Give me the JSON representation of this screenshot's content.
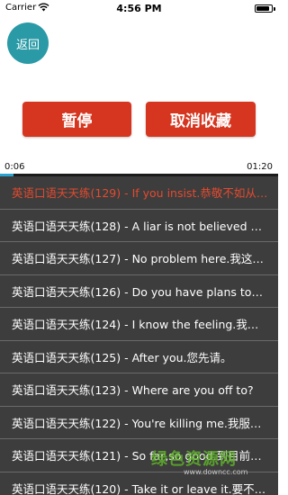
{
  "status_bar": {
    "carrier": "Carrier",
    "time": "4:56 PM",
    "battery_level": 0.9
  },
  "header": {
    "back_label": "返回"
  },
  "controls": {
    "pause_label": "暂停",
    "unfavorite_label": "取消收藏"
  },
  "player": {
    "elapsed": "0:06",
    "duration": "01:20",
    "progress": 0.05
  },
  "playlist": {
    "items": [
      {
        "label": "英语口语天天练(129) - If you insist.恭敬不如从命。",
        "playing": true
      },
      {
        "label": "英语口语天天练(128) - A liar is not believed when he speaks the truth.",
        "playing": false
      },
      {
        "label": "英语口语天天练(127) - No problem here.我这里没问题。",
        "playing": false
      },
      {
        "label": "英语口语天天练(126) - Do you have plans tonight?",
        "playing": false
      },
      {
        "label": "英语口语天天练(124) - I know the feeling.我懂那种感觉。",
        "playing": false
      },
      {
        "label": "英语口语天天练(125) - After you.您先请。",
        "playing": false
      },
      {
        "label": "英语口语天天练(123) - Where are you off to?",
        "playing": false
      },
      {
        "label": "英语口语天天练(122) - You're killing me.我服了你。",
        "playing": false
      },
      {
        "label": "英语口语天天练(121) - So far,so good.到目前为止还不错。",
        "playing": false
      },
      {
        "label": "英语口语天天练(120) - Take it or leave it.要不要随你。",
        "playing": false
      }
    ]
  },
  "watermark": {
    "title": "绿色资源网",
    "url": "www.downcc.com"
  }
}
